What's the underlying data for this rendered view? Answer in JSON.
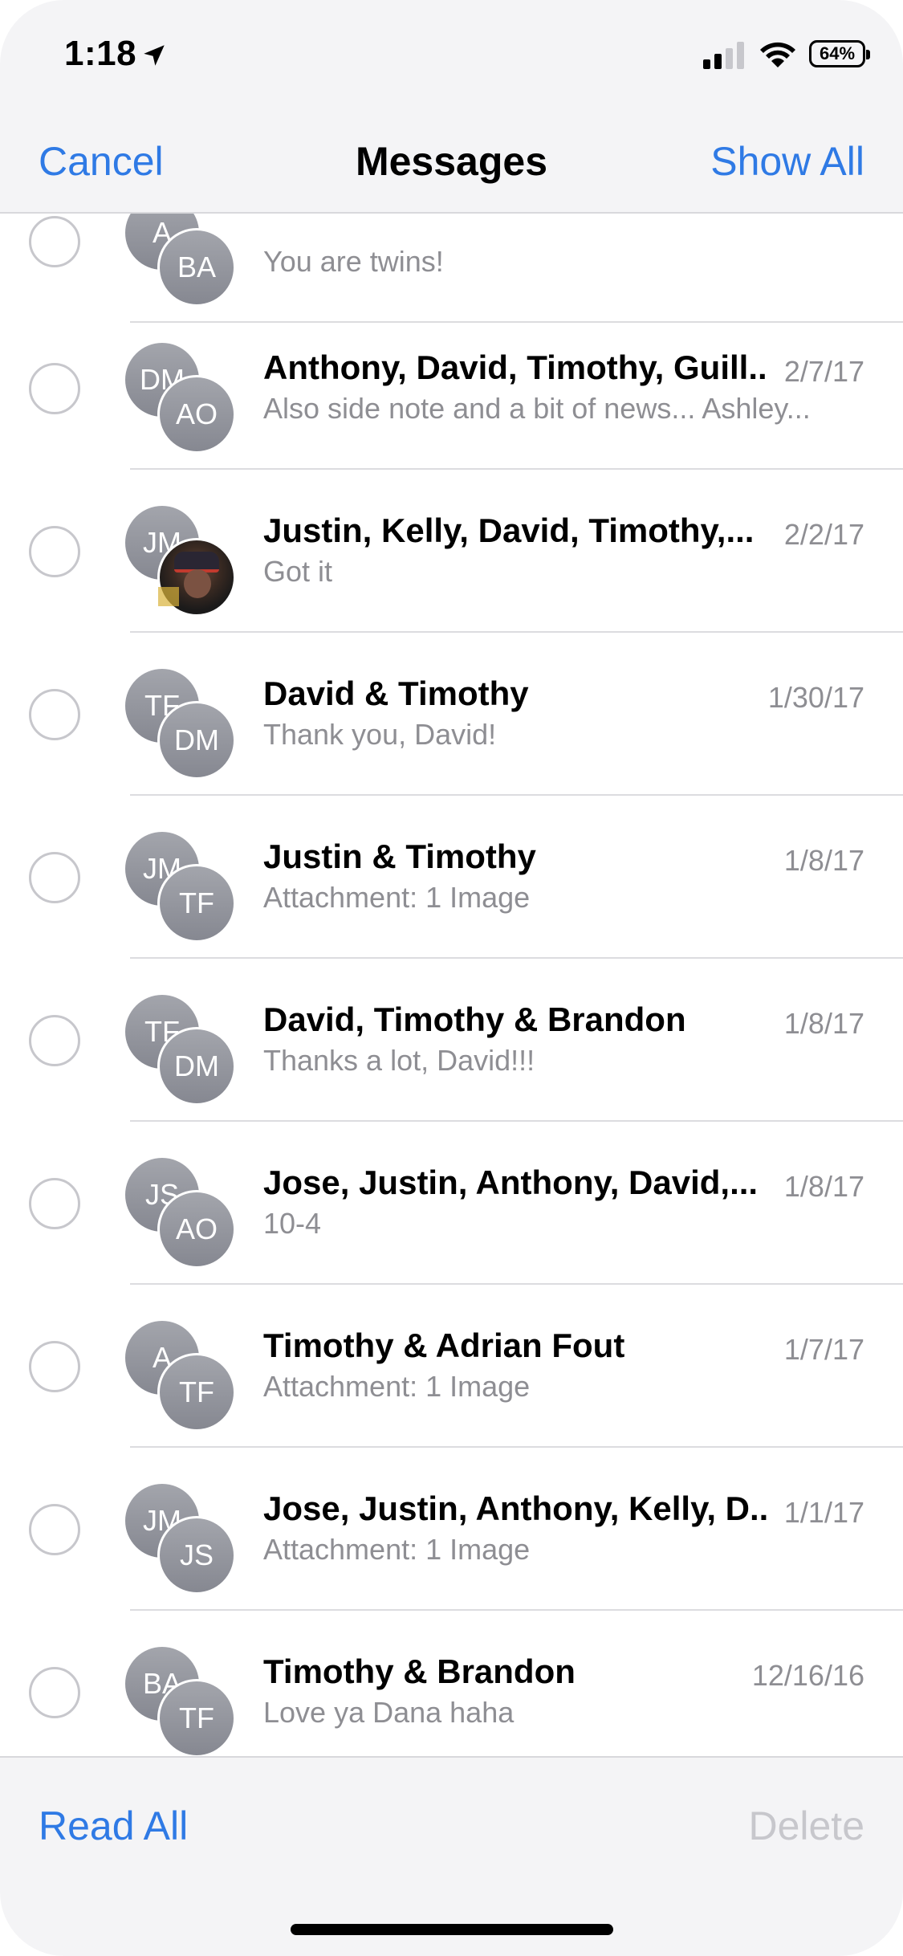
{
  "status_bar": {
    "time": "1:18",
    "battery": "64%",
    "icons": [
      "location-arrow-icon",
      "cellular-signal-icon",
      "wifi-icon",
      "battery-icon"
    ]
  },
  "nav": {
    "cancel": "Cancel",
    "title": "Messages",
    "show_all": "Show All"
  },
  "conversations": [
    {
      "initials_back": "A",
      "initials_front": "BA",
      "name": "",
      "date": "",
      "preview": "You are twins!"
    },
    {
      "initials_back": "DM",
      "initials_front": "AO",
      "name": "Anthony, David, Timothy, Guill...",
      "date": "2/7/17",
      "preview": "Also side note and a bit of news... Ashley..."
    },
    {
      "initials_back": "JM",
      "initials_front": "",
      "name": "Justin, Kelly, David, Timothy,...",
      "date": "2/2/17",
      "preview": "Got it"
    },
    {
      "initials_back": "TF",
      "initials_front": "DM",
      "name": "David & Timothy",
      "date": "1/30/17",
      "preview": "Thank you, David!"
    },
    {
      "initials_back": "JM",
      "initials_front": "TF",
      "name": "Justin & Timothy",
      "date": "1/8/17",
      "preview": "Attachment: 1 Image"
    },
    {
      "initials_back": "TF",
      "initials_front": "DM",
      "name": "David, Timothy & Brandon",
      "date": "1/8/17",
      "preview": "Thanks a lot, David!!!"
    },
    {
      "initials_back": "JS",
      "initials_front": "AO",
      "name": "Jose, Justin, Anthony, David,...",
      "date": "1/8/17",
      "preview": "10-4"
    },
    {
      "initials_back": "A",
      "initials_front": "TF",
      "name": "Timothy & Adrian Fout",
      "date": "1/7/17",
      "preview": "Attachment: 1 Image"
    },
    {
      "initials_back": "JM",
      "initials_front": "JS",
      "name": "Jose, Justin, Anthony, Kelly, D...",
      "date": "1/1/17",
      "preview": "Attachment: 1 Image"
    },
    {
      "initials_back": "BA",
      "initials_front": "TF",
      "name": "Timothy & Brandon",
      "date": "12/16/16",
      "preview": "Love ya Dana haha"
    }
  ],
  "toolbar": {
    "read_all": "Read All",
    "delete": "Delete"
  },
  "colors": {
    "accent": "#2f7ae5",
    "disabled": "#c7c7cc",
    "secondary_text": "#8e8e93",
    "bar_background": "#f4f4f6"
  }
}
